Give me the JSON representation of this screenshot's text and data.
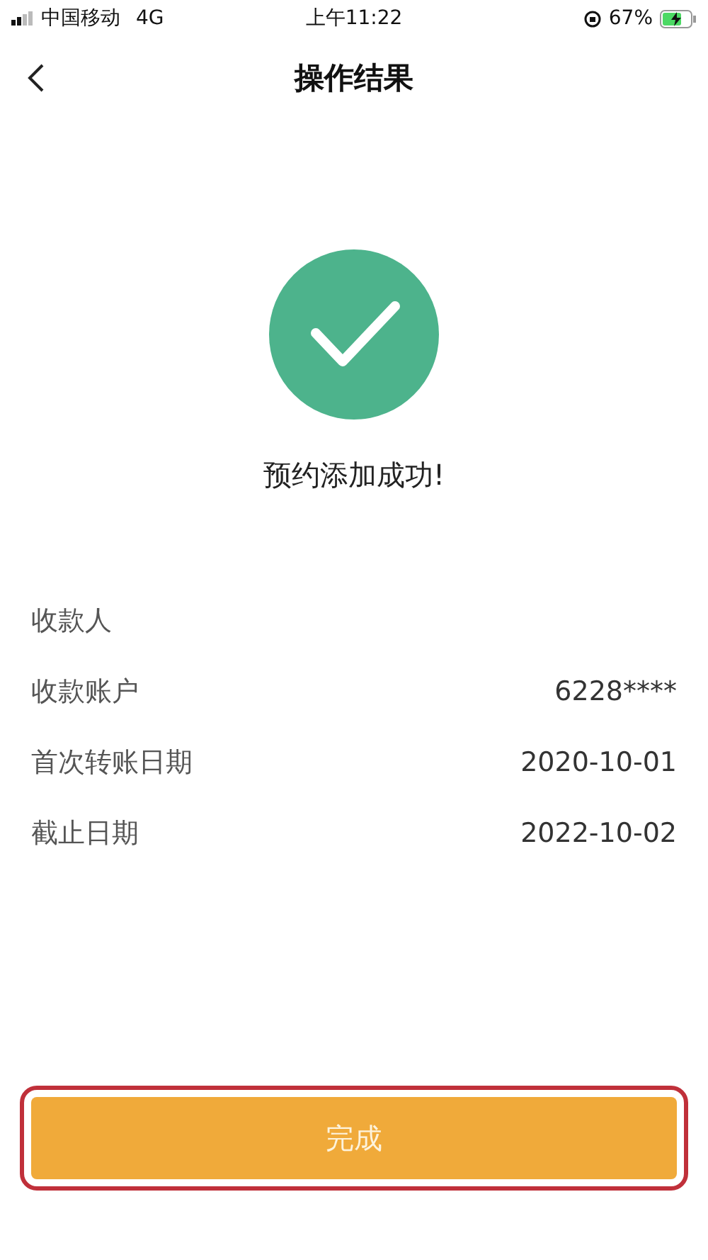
{
  "status_bar": {
    "carrier": "中国移动",
    "network": "4G",
    "time": "上午11:22",
    "battery": "67%",
    "charging": true
  },
  "nav": {
    "title": "操作结果"
  },
  "result": {
    "success": true,
    "message": "预约添加成功!"
  },
  "details": [
    {
      "label": "收款人"
    },
    {
      "label": "收款账户",
      "value": "6228****"
    },
    {
      "label": "首次转账日期",
      "value": "2020-10-01"
    },
    {
      "label": "截止日期",
      "value": "2022-10-02"
    }
  ],
  "primary_button": {
    "label": "完成",
    "highlighted": true
  }
}
